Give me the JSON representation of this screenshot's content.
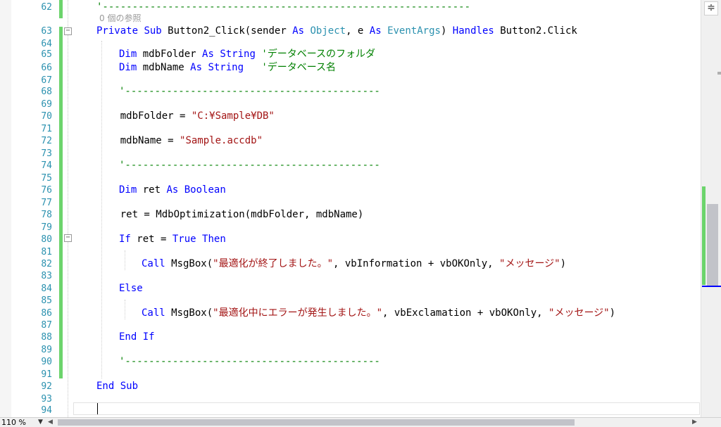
{
  "editor": {
    "line_numbers": [
      "62",
      "63",
      "64",
      "65",
      "66",
      "67",
      "68",
      "69",
      "70",
      "71",
      "72",
      "73",
      "74",
      "75",
      "76",
      "77",
      "78",
      "79",
      "80",
      "81",
      "82",
      "83",
      "84",
      "85",
      "86",
      "87",
      "88",
      "89",
      "90",
      "91",
      "92",
      "93",
      "94"
    ],
    "reference_hint": "0 個の参照",
    "lines": [
      [
        {
          "t": "'--------------------------------------------------------------",
          "c": "cm"
        }
      ],
      [
        {
          "t": "Private",
          "c": "kw"
        },
        {
          "t": " "
        },
        {
          "t": "Sub",
          "c": "kw"
        },
        {
          "t": " Button2_Click(sender "
        },
        {
          "t": "As",
          "c": "kw"
        },
        {
          "t": " "
        },
        {
          "t": "Object",
          "c": "ty"
        },
        {
          "t": ", e "
        },
        {
          "t": "As",
          "c": "kw"
        },
        {
          "t": " "
        },
        {
          "t": "EventArgs",
          "c": "ty"
        },
        {
          "t": ") "
        },
        {
          "t": "Handles",
          "c": "kw"
        },
        {
          "t": " Button2.Click"
        }
      ],
      [],
      [
        {
          "t": "    "
        },
        {
          "t": "Dim",
          "c": "kw"
        },
        {
          "t": " mdbFolder "
        },
        {
          "t": "As",
          "c": "kw"
        },
        {
          "t": " "
        },
        {
          "t": "String",
          "c": "kw"
        },
        {
          "t": " "
        },
        {
          "t": "'データベースのフォルダ",
          "c": "cm"
        }
      ],
      [
        {
          "t": "    "
        },
        {
          "t": "Dim",
          "c": "kw"
        },
        {
          "t": " mdbName "
        },
        {
          "t": "As",
          "c": "kw"
        },
        {
          "t": " "
        },
        {
          "t": "String",
          "c": "kw"
        },
        {
          "t": "   "
        },
        {
          "t": "'データベース名",
          "c": "cm"
        }
      ],
      [],
      [
        {
          "t": "    "
        },
        {
          "t": "'-------------------------------------------",
          "c": "cm"
        }
      ],
      [],
      [
        {
          "t": "    mdbFolder = "
        },
        {
          "t": "\"C:¥Sample¥DB\"",
          "c": "str"
        }
      ],
      [],
      [
        {
          "t": "    mdbName = "
        },
        {
          "t": "\"Sample.accdb\"",
          "c": "str"
        }
      ],
      [],
      [
        {
          "t": "    "
        },
        {
          "t": "'-------------------------------------------",
          "c": "cm"
        }
      ],
      [],
      [
        {
          "t": "    "
        },
        {
          "t": "Dim",
          "c": "kw"
        },
        {
          "t": " ret "
        },
        {
          "t": "As",
          "c": "kw"
        },
        {
          "t": " "
        },
        {
          "t": "Boolean",
          "c": "kw"
        }
      ],
      [],
      [
        {
          "t": "    ret = MdbOptimization(mdbFolder, mdbName)"
        }
      ],
      [],
      [
        {
          "t": "    "
        },
        {
          "t": "If",
          "c": "kw"
        },
        {
          "t": " ret = "
        },
        {
          "t": "True",
          "c": "kw"
        },
        {
          "t": " "
        },
        {
          "t": "Then",
          "c": "kw"
        }
      ],
      [],
      [
        {
          "t": "        "
        },
        {
          "t": "Call",
          "c": "kw"
        },
        {
          "t": " MsgBox("
        },
        {
          "t": "\"最適化が終了しました。\"",
          "c": "str"
        },
        {
          "t": ", vbInformation + vbOKOnly, "
        },
        {
          "t": "\"メッセージ\"",
          "c": "str"
        },
        {
          "t": ")"
        }
      ],
      [],
      [
        {
          "t": "    "
        },
        {
          "t": "Else",
          "c": "kw"
        }
      ],
      [],
      [
        {
          "t": "        "
        },
        {
          "t": "Call",
          "c": "kw"
        },
        {
          "t": " MsgBox("
        },
        {
          "t": "\"最適化中にエラーが発生しました。\"",
          "c": "str"
        },
        {
          "t": ", vbExclamation + vbOKOnly, "
        },
        {
          "t": "\"メッセージ\"",
          "c": "str"
        },
        {
          "t": ")"
        }
      ],
      [],
      [
        {
          "t": "    "
        },
        {
          "t": "End If",
          "c": "kw"
        }
      ],
      [],
      [
        {
          "t": "    "
        },
        {
          "t": "'-------------------------------------------",
          "c": "cm"
        }
      ],
      [],
      [
        {
          "t": "End Sub",
          "c": "kw"
        }
      ],
      [],
      []
    ]
  },
  "scrollbar": {
    "split_icon": "split-window-icon",
    "split_glyph": "≑"
  },
  "statusbar": {
    "zoom": "110 %",
    "zoom_dropdown_glyph": "▼",
    "left_arrow": "◀",
    "right_arrow": "▶"
  }
}
